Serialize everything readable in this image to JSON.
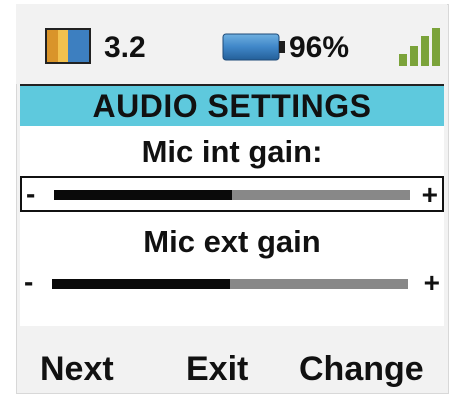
{
  "status": {
    "version": "3.2",
    "battery_percent": "96%",
    "battery_level": 0.96,
    "signal_bars_filled": 4,
    "sd_icon": "sd-card-icon",
    "battery_icon": "battery-icon",
    "signal_icon": "signal-strength-icon"
  },
  "title": "AUDIO SETTINGS",
  "settings": [
    {
      "label": "Mic int gain:",
      "level": 0.5,
      "minus": "-",
      "plus": "+",
      "selected": true
    },
    {
      "label": "Mic ext gain",
      "level": 0.5,
      "minus": "-",
      "plus": "+",
      "selected": false
    }
  ],
  "softkeys": {
    "left": "Next",
    "middle": "Exit",
    "right": "Change"
  },
  "colors": {
    "title_band": "#5ec9dd",
    "gain_fill": "#0a0a0a",
    "gain_track": "#888888"
  }
}
